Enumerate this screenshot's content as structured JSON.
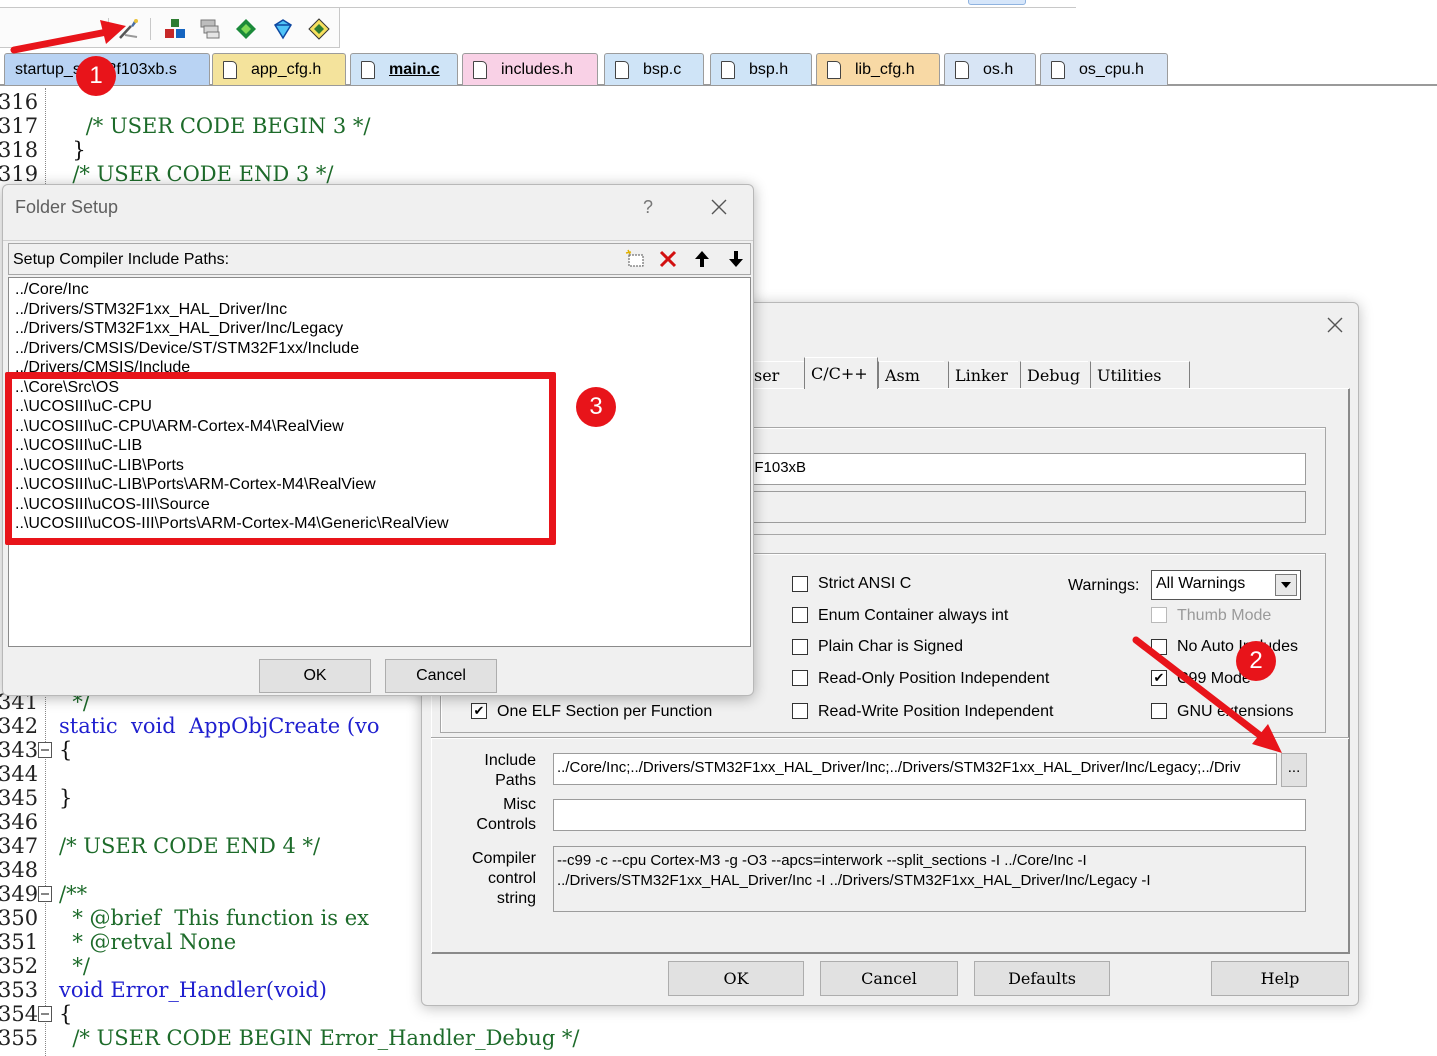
{
  "tabs": [
    {
      "label": "startup_stm32f103xb.s",
      "active": false,
      "color": "#b9d3f3"
    },
    {
      "label": "app_cfg.h",
      "active": false,
      "color": "#f4e39c"
    },
    {
      "label": "main.c",
      "active": true,
      "color": "#cfe4f7"
    },
    {
      "label": "includes.h",
      "active": false,
      "color": "#f9d1e6"
    },
    {
      "label": "bsp.c",
      "active": false,
      "color": "#cfe4f7"
    },
    {
      "label": "bsp.h",
      "active": false,
      "color": "#cfe4f7"
    },
    {
      "label": "lib_cfg.h",
      "active": false,
      "color": "#f8d9a5"
    },
    {
      "label": "os.h",
      "active": false,
      "color": "#d8e5f5"
    },
    {
      "label": "os_cpu.h",
      "active": false,
      "color": "#d8e5f5"
    }
  ],
  "toolbar": {
    "icons": [
      "wizard-icon",
      "manage-components-icon",
      "select-packs-icon",
      "pack-installer-icon",
      "software-pack-icon",
      "build-target-icon"
    ]
  },
  "editor": {
    "lines": [
      {
        "n": "316",
        "text": ""
      },
      {
        "n": "317",
        "text": "    /* USER CODE BEGIN 3 */"
      },
      {
        "n": "318",
        "text": "  }"
      },
      {
        "n": "319",
        "text": "  /* USER CODE END 3 */"
      },
      {
        "n": "341",
        "text": "  */"
      },
      {
        "n": "342",
        "text": "static  void  AppObjCreate (vo"
      },
      {
        "n": "343",
        "text": "{"
      },
      {
        "n": "344",
        "text": ""
      },
      {
        "n": "345",
        "text": "}"
      },
      {
        "n": "346",
        "text": ""
      },
      {
        "n": "347",
        "text": "/* USER CODE END 4 */"
      },
      {
        "n": "348",
        "text": ""
      },
      {
        "n": "349",
        "text": "/**"
      },
      {
        "n": "350",
        "text": "  * @brief  This function is ex"
      },
      {
        "n": "351",
        "text": "  * @retval None"
      },
      {
        "n": "352",
        "text": "  */"
      },
      {
        "n": "353",
        "text": "void Error_Handler(void)"
      },
      {
        "n": "354",
        "text": "{"
      },
      {
        "n": "355",
        "text": "  /* USER CODE BEGIN Error_Handler_Debug */"
      }
    ]
  },
  "folder_setup": {
    "title": "Folder Setup",
    "help_glyph": "?",
    "header_label": "Setup Compiler Include Paths:",
    "paths": [
      "../Core/Inc",
      "../Drivers/STM32F1xx_HAL_Driver/Inc",
      "../Drivers/STM32F1xx_HAL_Driver/Inc/Legacy",
      "../Drivers/CMSIS/Device/ST/STM32F1xx/Include",
      "../Drivers/CMSIS/Include",
      "..\\Core\\Src\\OS",
      "..\\UCOSIII\\uC-CPU",
      "..\\UCOSIII\\uC-CPU\\ARM-Cortex-M4\\RealView",
      "..\\UCOSIII\\uC-LIB",
      "..\\UCOSIII\\uC-LIB\\Ports",
      "..\\UCOSIII\\uC-LIB\\Ports\\ARM-Cortex-M4\\RealView",
      "..\\UCOSIII\\uCOS-III\\Source",
      "..\\UCOSIII\\uCOS-III\\Ports\\ARM-Cortex-M4\\Generic\\RealView"
    ],
    "ok_label": "OK",
    "cancel_label": "Cancel"
  },
  "options_dialog": {
    "tabs": [
      "ser",
      "C/C++",
      "Asm",
      "Linker",
      "Debug",
      "Utilities"
    ],
    "active_tab": "C/C++",
    "device_text": "2F103xB",
    "checkboxes": [
      {
        "label": "Strict ANSI C",
        "checked": false,
        "disabled": false
      },
      {
        "label": "Enum Container always int",
        "checked": false,
        "disabled": false
      },
      {
        "label": "Plain Char is Signed",
        "checked": false,
        "disabled": false
      },
      {
        "label": "Read-Only Position Independent",
        "checked": false,
        "disabled": false
      },
      {
        "label": "Read-Write Position Independent",
        "checked": false,
        "disabled": false
      },
      {
        "label": "One ELF Section per Function",
        "checked": true,
        "disabled": false
      },
      {
        "label": "Thumb Mode",
        "checked": false,
        "disabled": true
      },
      {
        "label": "No Auto Includes",
        "checked": false,
        "disabled": false
      },
      {
        "label": "C99 Mode",
        "checked": true,
        "disabled": false
      },
      {
        "label": "GNU extensions",
        "checked": false,
        "disabled": false
      }
    ],
    "warnings_label": "Warnings:",
    "warnings_value": "All Warnings",
    "include_paths_label": "Include Paths",
    "include_paths_value": "../Core/Inc;../Drivers/STM32F1xx_HAL_Driver/Inc;../Drivers/STM32F1xx_HAL_Driver/Inc/Legacy;../Driv",
    "browse_label": "...",
    "misc_controls_label": "Misc Controls",
    "misc_controls_value": "",
    "compiler_control_label": "Compiler control string",
    "compiler_control_value": "--c99 -c --cpu Cortex-M3 -g -O3 --apcs=interwork --split_sections -I ../Core/Inc -I ../Drivers/STM32F1xx_HAL_Driver/Inc -I ../Drivers/STM32F1xx_HAL_Driver/Inc/Legacy -I",
    "ok_label": "OK",
    "cancel_label": "Cancel",
    "defaults_label": "Defaults",
    "help_label": "Help"
  },
  "annotations": {
    "badge_1": "1",
    "badge_2": "2",
    "badge_3": "3",
    "color": "#e8141a"
  }
}
